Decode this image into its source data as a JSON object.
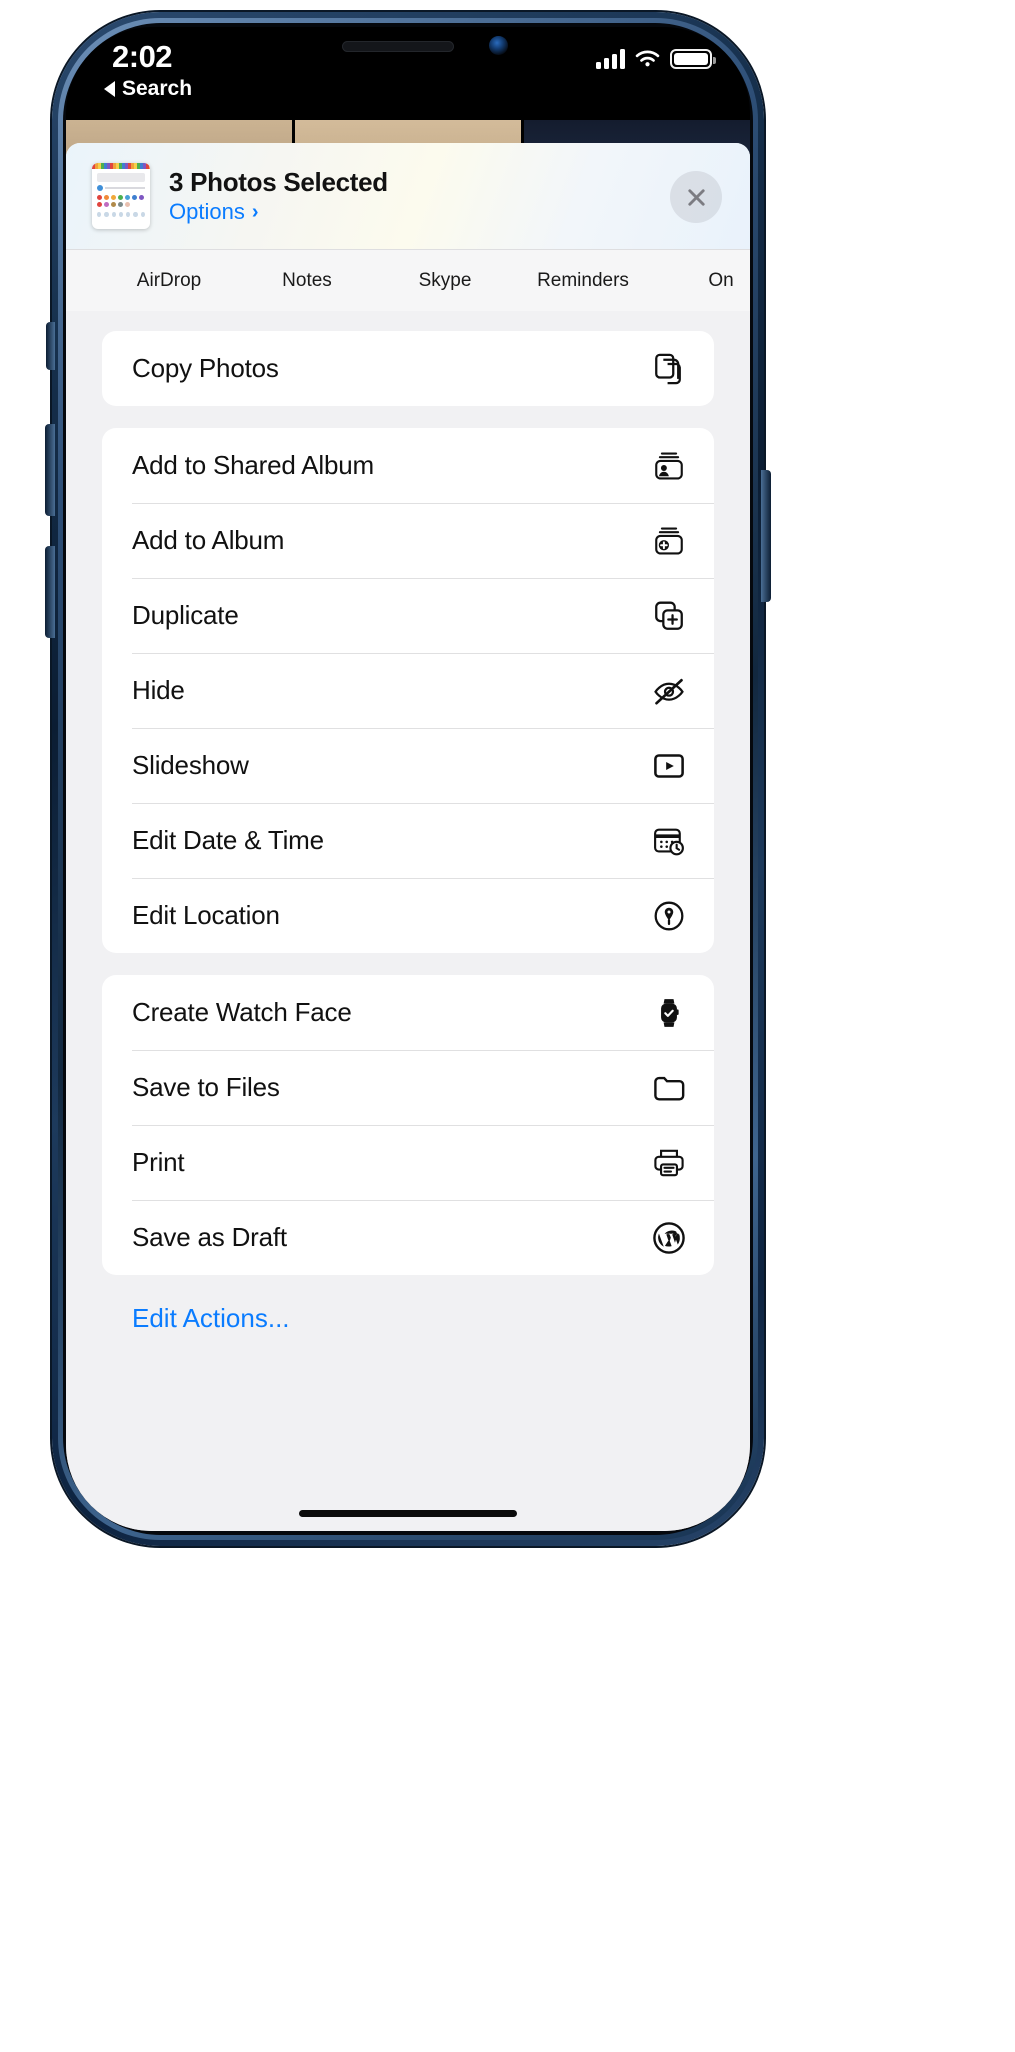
{
  "status_bar": {
    "time": "2:02",
    "back_label": "Search",
    "signal_icon": "cellular-signal-icon",
    "wifi_icon": "wifi-icon",
    "battery_icon": "battery-full-icon"
  },
  "sheet": {
    "title": "3 Photos Selected",
    "options_label": "Options",
    "options_chevron": "›",
    "close_icon": "close-icon",
    "thumbnail_name": "photo-thumbnail"
  },
  "apps": [
    {
      "label": "AirDrop"
    },
    {
      "label": "Notes"
    },
    {
      "label": "Skype"
    },
    {
      "label": "Reminders"
    },
    {
      "label": "On"
    }
  ],
  "groups": [
    {
      "items": [
        {
          "label": "Copy Photos",
          "icon": "copy-icon"
        }
      ]
    },
    {
      "items": [
        {
          "label": "Add to Shared Album",
          "icon": "shared-album-icon"
        },
        {
          "label": "Add to Album",
          "icon": "add-album-icon"
        },
        {
          "label": "Duplicate",
          "icon": "duplicate-icon"
        },
        {
          "label": "Hide",
          "icon": "eye-slash-icon"
        },
        {
          "label": "Slideshow",
          "icon": "play-rectangle-icon"
        },
        {
          "label": "Edit Date & Time",
          "icon": "calendar-clock-icon"
        },
        {
          "label": "Edit Location",
          "icon": "location-pin-circle-icon"
        }
      ]
    },
    {
      "items": [
        {
          "label": "Create Watch Face",
          "icon": "apple-watch-icon"
        },
        {
          "label": "Save to Files",
          "icon": "folder-icon"
        },
        {
          "label": "Print",
          "icon": "printer-icon"
        },
        {
          "label": "Save as Draft",
          "icon": "wordpress-icon"
        }
      ]
    }
  ],
  "edit_actions_label": "Edit Actions...",
  "colors": {
    "accent_blue": "#0a7cff",
    "sheet_background": "#f1f1f3",
    "row_background": "#ffffff",
    "text_primary": "#111111"
  }
}
